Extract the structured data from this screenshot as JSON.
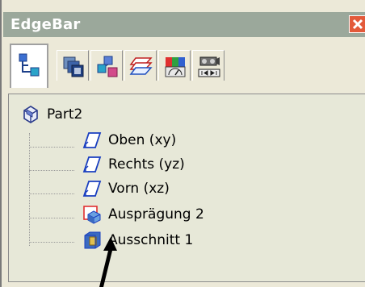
{
  "titlebar": {
    "title": "EdgeBar",
    "close_icon": "close-icon"
  },
  "tabs": [
    {
      "icon": "feature-tree-icon",
      "active": true
    },
    {
      "icon": "layers-stack-icon",
      "active": false
    },
    {
      "icon": "assembly-parts-icon",
      "active": false
    },
    {
      "icon": "sheets-icon",
      "active": false
    },
    {
      "icon": "color-gauge-icon",
      "active": false
    },
    {
      "icon": "camera-playback-icon",
      "active": false
    }
  ],
  "tree": {
    "root": {
      "label": "Part2",
      "icon": "part-icon"
    },
    "items": [
      {
        "label": "Oben (xy)",
        "icon": "reference-plane-icon"
      },
      {
        "label": "Rechts (yz)",
        "icon": "reference-plane-icon"
      },
      {
        "label": "Vorn (xz)",
        "icon": "reference-plane-icon"
      },
      {
        "label": "Ausprägung 2",
        "icon": "protrusion-icon"
      },
      {
        "label": "Ausschnitt 1",
        "icon": "cutout-icon"
      }
    ]
  },
  "pointer": {
    "icon": "arrow-pointer"
  }
}
